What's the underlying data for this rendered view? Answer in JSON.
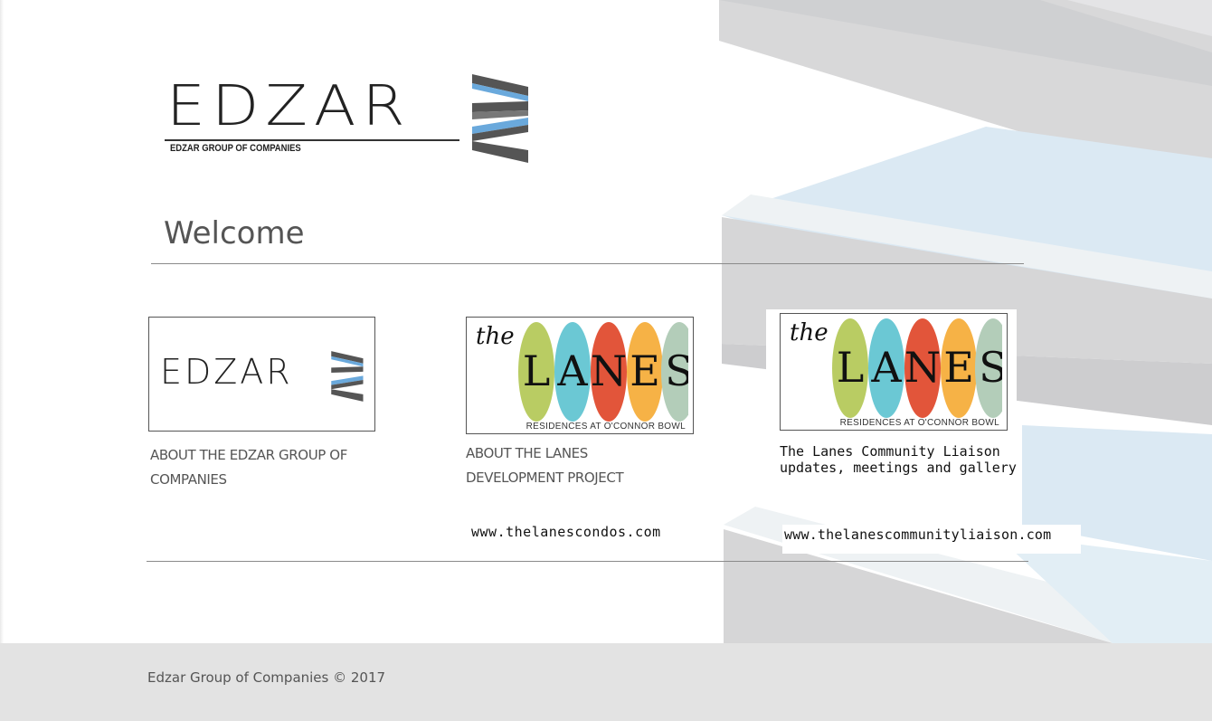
{
  "header": {
    "logo_wordmark": "EDZAR",
    "logo_tagline": "EDZAR GROUP OF COMPANIES"
  },
  "main": {
    "heading": "Welcome",
    "cards": [
      {
        "title": "ABOUT THE EDZAR GROUP OF COMPANIES",
        "image_wordmark": "EDZAR"
      },
      {
        "title": "ABOUT THE LANES DEVELOPMENT PROJECT",
        "url": "www.thelanescondos.com"
      },
      {
        "title": "The Lanes Community Liaison updates, meetings and gallery",
        "url": "www.thelanescommunityliaison.com"
      }
    ],
    "lanes_logo": {
      "prefix": "the",
      "letters": [
        "L",
        "A",
        "N",
        "E",
        "S"
      ],
      "subtitle": "RESIDENCES AT O'CONNOR BOWL",
      "colors": [
        "#b9cc63",
        "#6bc8d4",
        "#e2553a",
        "#f6b246",
        "#b3cdb9"
      ]
    }
  },
  "footer": {
    "copyright": "Edzar Group of Companies © 2017"
  },
  "colors": {
    "logo_blue": "#6aa9dc",
    "logo_gray": "#555555",
    "footer_bg": "#e3e3e3"
  }
}
